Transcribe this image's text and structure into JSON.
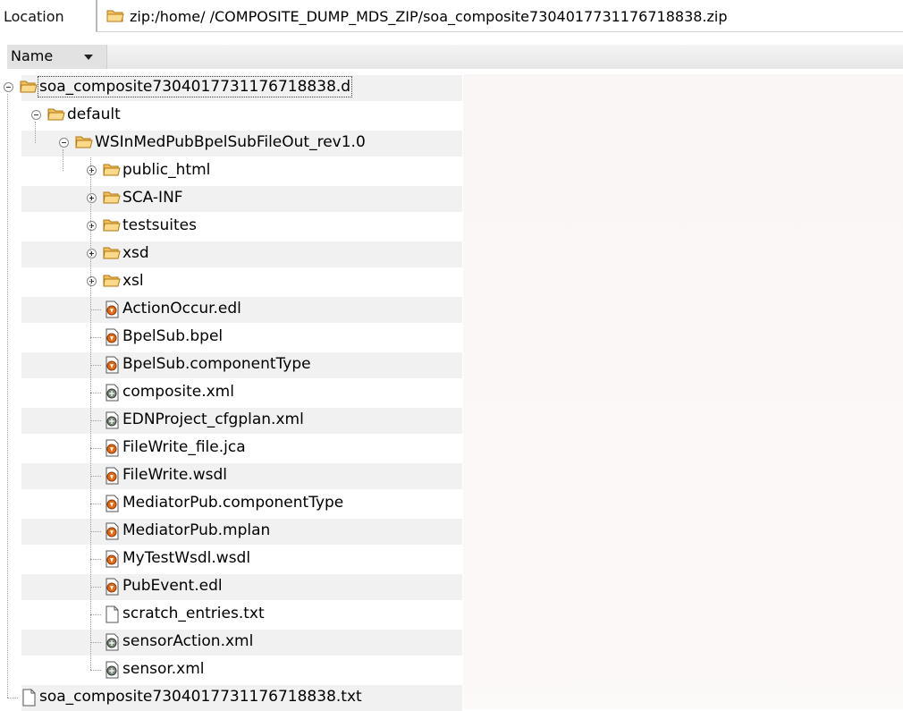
{
  "location": {
    "label": "Location",
    "value": "zip:/home/     /COMPOSITE_DUMP_MDS_ZIP/soa_composite7304017731176718838.zip",
    "icon": "folder-icon"
  },
  "columns": {
    "name": "Name"
  },
  "tree": [
    {
      "label": "soa_composite7304017731176718838.d",
      "type": "folder",
      "level": 0,
      "expanded": true,
      "selected": true
    },
    {
      "label": "default",
      "type": "folder",
      "level": 1,
      "expanded": true
    },
    {
      "label": "WSInMedPubBpelSubFileOut_rev1.0",
      "type": "folder",
      "level": 2,
      "expanded": true
    },
    {
      "label": "public_html",
      "type": "folder",
      "level": 3,
      "expanded": false
    },
    {
      "label": "SCA-INF",
      "type": "folder",
      "level": 3,
      "expanded": false
    },
    {
      "label": "testsuites",
      "type": "folder",
      "level": 3,
      "expanded": false
    },
    {
      "label": "xsd",
      "type": "folder",
      "level": 3,
      "expanded": false
    },
    {
      "label": "xsl",
      "type": "folder",
      "level": 3,
      "expanded": false
    },
    {
      "label": "ActionOccur.edl",
      "type": "orange-file",
      "level": 3
    },
    {
      "label": "BpelSub.bpel",
      "type": "orange-file",
      "level": 3
    },
    {
      "label": "BpelSub.componentType",
      "type": "orange-file",
      "level": 3
    },
    {
      "label": "composite.xml",
      "type": "xml-file",
      "level": 3
    },
    {
      "label": "EDNProject_cfgplan.xml",
      "type": "xml-file",
      "level": 3
    },
    {
      "label": "FileWrite_file.jca",
      "type": "orange-file",
      "level": 3
    },
    {
      "label": "FileWrite.wsdl",
      "type": "orange-file",
      "level": 3
    },
    {
      "label": "MediatorPub.componentType",
      "type": "orange-file",
      "level": 3
    },
    {
      "label": "MediatorPub.mplan",
      "type": "orange-file",
      "level": 3
    },
    {
      "label": "MyTestWsdl.wsdl",
      "type": "orange-file",
      "level": 3
    },
    {
      "label": "PubEvent.edl",
      "type": "orange-file",
      "level": 3
    },
    {
      "label": "scratch_entries.txt",
      "type": "text-file",
      "level": 3
    },
    {
      "label": "sensorAction.xml",
      "type": "xml-file",
      "level": 3
    },
    {
      "label": "sensor.xml",
      "type": "xml-file",
      "level": 3
    },
    {
      "label": "soa_composite7304017731176718838.txt",
      "type": "text-file",
      "level": 0
    }
  ]
}
